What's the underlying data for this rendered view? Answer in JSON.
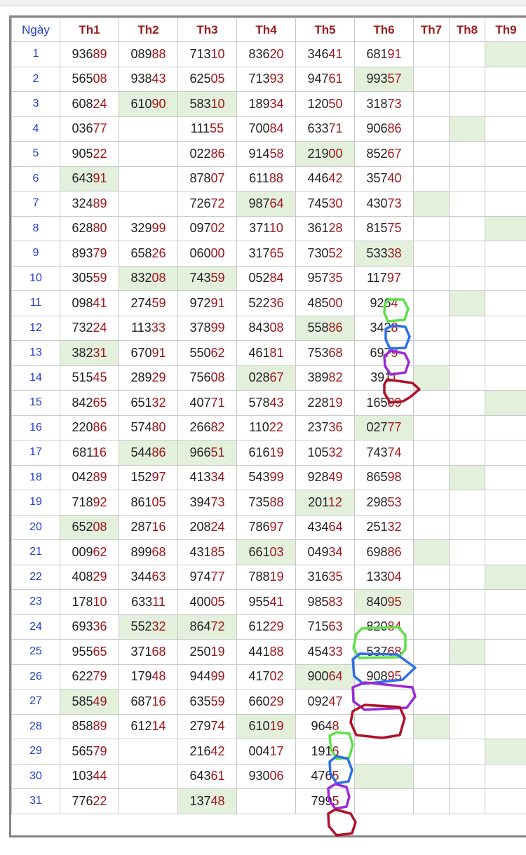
{
  "table": {
    "headers": [
      "Ngày",
      "Th1",
      "Th2",
      "Th3",
      "Th4",
      "Th5",
      "Th6",
      "Th7",
      "Th8",
      "Th9"
    ],
    "rows": [
      {
        "day": "1",
        "cells": [
          [
            "936",
            "89"
          ],
          [
            "089",
            "88"
          ],
          [
            "713",
            "10"
          ],
          [
            "836",
            "20"
          ],
          [
            "346",
            "41"
          ],
          [
            "681",
            "91"
          ],
          [
            "",
            ""
          ],
          [
            "",
            ""
          ],
          [
            "",
            ""
          ]
        ]
      },
      {
        "day": "2",
        "cells": [
          [
            "565",
            "08"
          ],
          [
            "938",
            "43"
          ],
          [
            "625",
            "05"
          ],
          [
            "713",
            "93"
          ],
          [
            "947",
            "61"
          ],
          [
            "993",
            "57"
          ],
          [
            "",
            ""
          ],
          [
            "",
            ""
          ],
          [
            "",
            ""
          ]
        ]
      },
      {
        "day": "3",
        "cells": [
          [
            "608",
            "24"
          ],
          [
            "610",
            "90"
          ],
          [
            "583",
            "10"
          ],
          [
            "189",
            "34"
          ],
          [
            "120",
            "50"
          ],
          [
            "318",
            "73"
          ],
          [
            "",
            ""
          ],
          [
            "",
            ""
          ],
          [
            "",
            ""
          ]
        ]
      },
      {
        "day": "4",
        "cells": [
          [
            "036",
            "77"
          ],
          [
            "",
            ""
          ],
          [
            "111",
            "55"
          ],
          [
            "700",
            "84"
          ],
          [
            "633",
            "71"
          ],
          [
            "906",
            "86"
          ],
          [
            "",
            ""
          ],
          [
            "",
            ""
          ],
          [
            "",
            ""
          ]
        ]
      },
      {
        "day": "5",
        "cells": [
          [
            "905",
            "22"
          ],
          [
            "",
            ""
          ],
          [
            "022",
            "86"
          ],
          [
            "914",
            "58"
          ],
          [
            "219",
            "00"
          ],
          [
            "852",
            "67"
          ],
          [
            "",
            ""
          ],
          [
            "",
            ""
          ],
          [
            "",
            ""
          ]
        ]
      },
      {
        "day": "6",
        "cells": [
          [
            "643",
            "91"
          ],
          [
            "",
            ""
          ],
          [
            "878",
            "07"
          ],
          [
            "611",
            "88"
          ],
          [
            "446",
            "42"
          ],
          [
            "357",
            "40"
          ],
          [
            "",
            ""
          ],
          [
            "",
            ""
          ],
          [
            "",
            ""
          ]
        ]
      },
      {
        "day": "7",
        "cells": [
          [
            "324",
            "89"
          ],
          [
            "",
            ""
          ],
          [
            "726",
            "72"
          ],
          [
            "987",
            "64"
          ],
          [
            "745",
            "30"
          ],
          [
            "430",
            "73"
          ],
          [
            "",
            ""
          ],
          [
            "",
            ""
          ],
          [
            "",
            ""
          ]
        ]
      },
      {
        "day": "8",
        "cells": [
          [
            "628",
            "80"
          ],
          [
            "329",
            "99"
          ],
          [
            "097",
            "02"
          ],
          [
            "371",
            "10"
          ],
          [
            "361",
            "28"
          ],
          [
            "815",
            "75"
          ],
          [
            "",
            ""
          ],
          [
            "",
            ""
          ],
          [
            "",
            ""
          ]
        ]
      },
      {
        "day": "9",
        "cells": [
          [
            "893",
            "79"
          ],
          [
            "658",
            "26"
          ],
          [
            "060",
            "00"
          ],
          [
            "317",
            "65"
          ],
          [
            "730",
            "52"
          ],
          [
            "533",
            "38"
          ],
          [
            "",
            ""
          ],
          [
            "",
            ""
          ],
          [
            "",
            ""
          ]
        ]
      },
      {
        "day": "10",
        "cells": [
          [
            "305",
            "59"
          ],
          [
            "832",
            "08"
          ],
          [
            "743",
            "59"
          ],
          [
            "052",
            "84"
          ],
          [
            "957",
            "35"
          ],
          [
            "117",
            "97"
          ],
          [
            "",
            ""
          ],
          [
            "",
            ""
          ],
          [
            "",
            ""
          ]
        ]
      },
      {
        "day": "11",
        "cells": [
          [
            "098",
            "41"
          ],
          [
            "274",
            "59"
          ],
          [
            "972",
            "91"
          ],
          [
            "522",
            "36"
          ],
          [
            "485",
            "00"
          ],
          [
            "926",
            "4"
          ],
          [
            "",
            ""
          ],
          [
            "",
            ""
          ],
          [
            "",
            ""
          ]
        ]
      },
      {
        "day": "12",
        "cells": [
          [
            "732",
            "24"
          ],
          [
            "113",
            "33"
          ],
          [
            "378",
            "99"
          ],
          [
            "843",
            "08"
          ],
          [
            "558",
            "86"
          ],
          [
            "342",
            "8"
          ],
          [
            "",
            ""
          ],
          [
            "",
            ""
          ],
          [
            "",
            ""
          ]
        ]
      },
      {
        "day": "13",
        "cells": [
          [
            "382",
            "31"
          ],
          [
            "670",
            "91"
          ],
          [
            "550",
            "62"
          ],
          [
            "461",
            "81"
          ],
          [
            "753",
            "68"
          ],
          [
            "697",
            "9"
          ],
          [
            "",
            ""
          ],
          [
            "",
            ""
          ],
          [
            "",
            ""
          ]
        ]
      },
      {
        "day": "14",
        "cells": [
          [
            "515",
            "45"
          ],
          [
            "289",
            "29"
          ],
          [
            "756",
            "08"
          ],
          [
            "028",
            "67"
          ],
          [
            "389",
            "82"
          ],
          [
            "391",
            "1"
          ],
          [
            "",
            ""
          ],
          [
            "",
            ""
          ],
          [
            "",
            ""
          ]
        ]
      },
      {
        "day": "15",
        "cells": [
          [
            "842",
            "65"
          ],
          [
            "651",
            "32"
          ],
          [
            "407",
            "71"
          ],
          [
            "578",
            "43"
          ],
          [
            "228",
            "19"
          ],
          [
            "165",
            "09"
          ],
          [
            "",
            ""
          ],
          [
            "",
            ""
          ],
          [
            "",
            ""
          ]
        ]
      },
      {
        "day": "16",
        "cells": [
          [
            "220",
            "86"
          ],
          [
            "574",
            "80"
          ],
          [
            "266",
            "82"
          ],
          [
            "110",
            "22"
          ],
          [
            "237",
            "36"
          ],
          [
            "027",
            "77"
          ],
          [
            "",
            ""
          ],
          [
            "",
            ""
          ],
          [
            "",
            ""
          ]
        ]
      },
      {
        "day": "17",
        "cells": [
          [
            "681",
            "16"
          ],
          [
            "544",
            "86"
          ],
          [
            "966",
            "51"
          ],
          [
            "616",
            "19"
          ],
          [
            "105",
            "32"
          ],
          [
            "743",
            "74"
          ],
          [
            "",
            ""
          ],
          [
            "",
            ""
          ],
          [
            "",
            ""
          ]
        ]
      },
      {
        "day": "18",
        "cells": [
          [
            "042",
            "89"
          ],
          [
            "152",
            "97"
          ],
          [
            "413",
            "34"
          ],
          [
            "543",
            "99"
          ],
          [
            "928",
            "49"
          ],
          [
            "865",
            "98"
          ],
          [
            "",
            ""
          ],
          [
            "",
            ""
          ],
          [
            "",
            ""
          ]
        ]
      },
      {
        "day": "19",
        "cells": [
          [
            "718",
            "92"
          ],
          [
            "861",
            "05"
          ],
          [
            "394",
            "73"
          ],
          [
            "735",
            "88"
          ],
          [
            "201",
            "12"
          ],
          [
            "298",
            "53"
          ],
          [
            "",
            ""
          ],
          [
            "",
            ""
          ],
          [
            "",
            ""
          ]
        ]
      },
      {
        "day": "20",
        "cells": [
          [
            "652",
            "08"
          ],
          [
            "287",
            "16"
          ],
          [
            "208",
            "24"
          ],
          [
            "786",
            "97"
          ],
          [
            "434",
            "64"
          ],
          [
            "251",
            "32"
          ],
          [
            "",
            ""
          ],
          [
            "",
            ""
          ],
          [
            "",
            ""
          ]
        ]
      },
      {
        "day": "21",
        "cells": [
          [
            "009",
            "62"
          ],
          [
            "899",
            "68"
          ],
          [
            "431",
            "85"
          ],
          [
            "661",
            "03"
          ],
          [
            "049",
            "34"
          ],
          [
            "698",
            "86"
          ],
          [
            "",
            ""
          ],
          [
            "",
            ""
          ],
          [
            "",
            ""
          ]
        ]
      },
      {
        "day": "22",
        "cells": [
          [
            "408",
            "29"
          ],
          [
            "344",
            "63"
          ],
          [
            "974",
            "77"
          ],
          [
            "788",
            "19"
          ],
          [
            "316",
            "35"
          ],
          [
            "133",
            "04"
          ],
          [
            "",
            ""
          ],
          [
            "",
            ""
          ],
          [
            "",
            ""
          ]
        ]
      },
      {
        "day": "23",
        "cells": [
          [
            "178",
            "10"
          ],
          [
            "633",
            "11"
          ],
          [
            "400",
            "05"
          ],
          [
            "955",
            "41"
          ],
          [
            "985",
            "83"
          ],
          [
            "840",
            "95"
          ],
          [
            "",
            ""
          ],
          [
            "",
            ""
          ],
          [
            "",
            ""
          ]
        ]
      },
      {
        "day": "24",
        "cells": [
          [
            "693",
            "36"
          ],
          [
            "552",
            "32"
          ],
          [
            "864",
            "72"
          ],
          [
            "612",
            "29"
          ],
          [
            "715",
            "63"
          ],
          [
            "820",
            "84"
          ],
          [
            "",
            ""
          ],
          [
            "",
            ""
          ],
          [
            "",
            ""
          ]
        ]
      },
      {
        "day": "25",
        "cells": [
          [
            "955",
            "65"
          ],
          [
            "371",
            "68"
          ],
          [
            "250",
            "19"
          ],
          [
            "441",
            "88"
          ],
          [
            "454",
            "33"
          ],
          [
            "537",
            "68"
          ],
          [
            "",
            ""
          ],
          [
            "",
            ""
          ],
          [
            "",
            ""
          ]
        ]
      },
      {
        "day": "26",
        "cells": [
          [
            "622",
            "79"
          ],
          [
            "179",
            "48"
          ],
          [
            "944",
            "99"
          ],
          [
            "417",
            "02"
          ],
          [
            "900",
            "64"
          ],
          [
            "908",
            "95"
          ],
          [
            "",
            ""
          ],
          [
            "",
            ""
          ],
          [
            "",
            ""
          ]
        ]
      },
      {
        "day": "27",
        "cells": [
          [
            "585",
            "49"
          ],
          [
            "687",
            "16"
          ],
          [
            "635",
            "59"
          ],
          [
            "660",
            "29"
          ],
          [
            "092",
            "47"
          ],
          [
            "",
            ""
          ],
          [
            "",
            ""
          ],
          [
            "",
            ""
          ],
          [
            "",
            ""
          ]
        ]
      },
      {
        "day": "28",
        "cells": [
          [
            "858",
            "89"
          ],
          [
            "612",
            "14"
          ],
          [
            "279",
            "74"
          ],
          [
            "610",
            "19"
          ],
          [
            "964",
            "8"
          ],
          [
            "",
            ""
          ],
          [
            "",
            ""
          ],
          [
            "",
            ""
          ],
          [
            "",
            ""
          ]
        ]
      },
      {
        "day": "29",
        "cells": [
          [
            "565",
            "79"
          ],
          [
            "",
            ""
          ],
          [
            "216",
            "42"
          ],
          [
            "004",
            "17"
          ],
          [
            "191",
            "6"
          ],
          [
            "",
            ""
          ],
          [
            "",
            ""
          ],
          [
            "",
            ""
          ],
          [
            "",
            ""
          ]
        ]
      },
      {
        "day": "30",
        "cells": [
          [
            "103",
            "44"
          ],
          [
            "",
            ""
          ],
          [
            "643",
            "61"
          ],
          [
            "930",
            "06"
          ],
          [
            "476",
            "5"
          ],
          [
            "",
            ""
          ],
          [
            "",
            ""
          ],
          [
            "",
            ""
          ],
          [
            "",
            ""
          ]
        ]
      },
      {
        "day": "31",
        "cells": [
          [
            "776",
            "22"
          ],
          [
            "",
            ""
          ],
          [
            "137",
            "48"
          ],
          [
            "",
            ""
          ],
          [
            "799",
            "5"
          ],
          [
            "",
            ""
          ],
          [
            "",
            ""
          ],
          [
            "",
            ""
          ],
          [
            "",
            ""
          ]
        ]
      }
    ]
  },
  "colors": {
    "header_text": "#9b1b1b",
    "day_text": "#1f3fc8",
    "suffix_text": "#a1171c",
    "highlight_bg": "#e3f0dc",
    "annotation_green": "#5fe04a",
    "annotation_blue": "#2f6fe8",
    "annotation_purple": "#9b2bd6",
    "annotation_red": "#b0102a"
  }
}
